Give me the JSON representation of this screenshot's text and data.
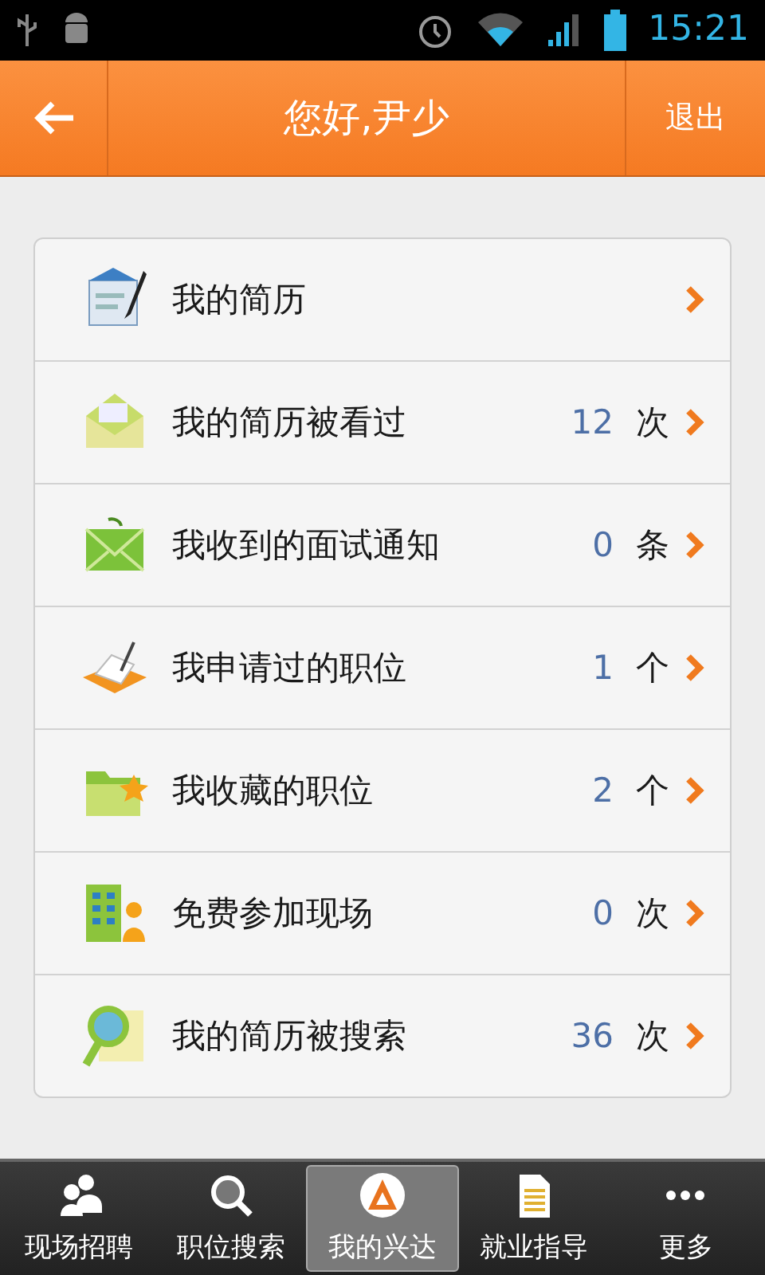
{
  "status_bar": {
    "time": "15:21"
  },
  "header": {
    "title": "您好,尹少",
    "action": "退出"
  },
  "menu": [
    {
      "label": "我的简历"
    },
    {
      "label": "我的简历被看过",
      "count": "12",
      "unit": "次"
    },
    {
      "label": "我收到的面试通知",
      "count": "0",
      "unit": "条"
    },
    {
      "label": "我申请过的职位",
      "count": "1",
      "unit": "个"
    },
    {
      "label": "我收藏的职位",
      "count": "2",
      "unit": "个"
    },
    {
      "label": "免费参加现场",
      "count": "0",
      "unit": "次"
    },
    {
      "label": "我的简历被搜索",
      "count": "36",
      "unit": "次"
    }
  ],
  "tabs": [
    {
      "label": "现场招聘",
      "selected": false
    },
    {
      "label": "职位搜索",
      "selected": false
    },
    {
      "label": "我的兴达",
      "selected": true
    },
    {
      "label": "就业指导",
      "selected": false
    },
    {
      "label": "更多",
      "selected": false
    }
  ]
}
